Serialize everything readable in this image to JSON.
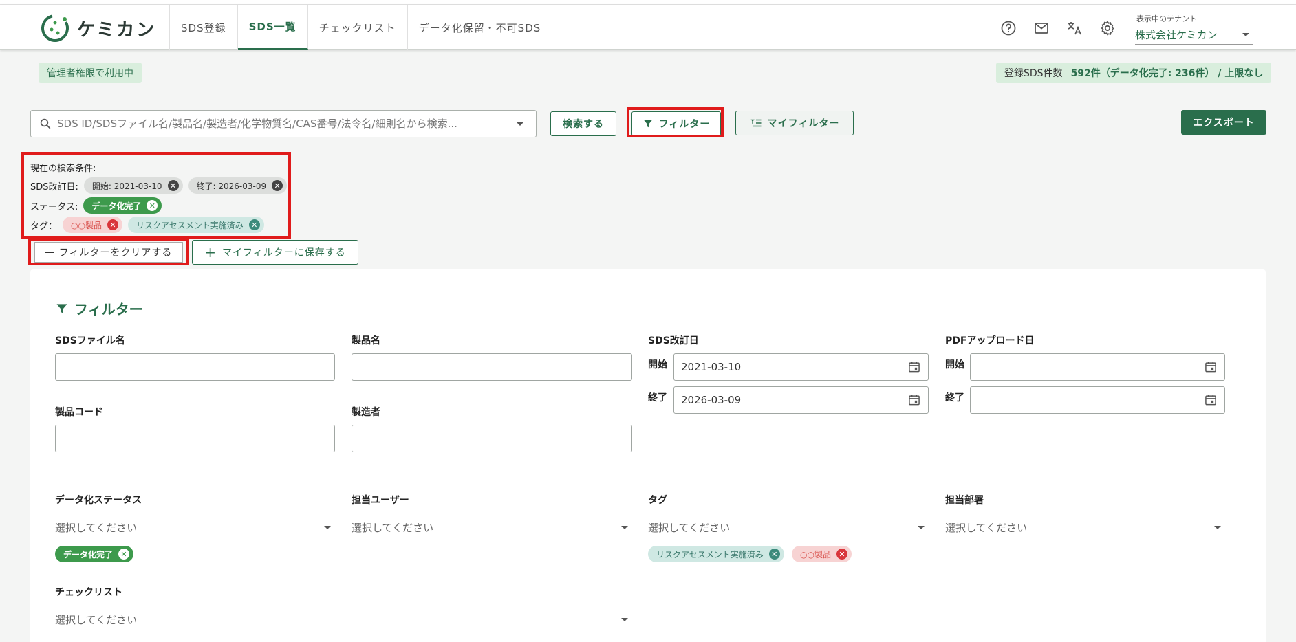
{
  "app": {
    "logo_text": "ケミカン"
  },
  "nav": {
    "tabs": [
      {
        "label": "SDS登録"
      },
      {
        "label": "SDS一覧"
      },
      {
        "label": "チェックリスト"
      },
      {
        "label": "データ化保留・不可SDS"
      }
    ]
  },
  "header": {
    "icons": [
      "help-icon",
      "mail-icon",
      "translate-icon",
      "gear-icon"
    ],
    "tenant_label": "表示中のテナント",
    "tenant_value": "株式会社ケミカン"
  },
  "badges": {
    "admin": "管理者権限で利用中",
    "count_label": "登録SDS件数",
    "count_value": "592件（データ化完了: 236件） / 上限なし"
  },
  "search": {
    "placeholder": "SDS ID/SDSファイル名/製品名/製造者/化学物質名/CAS番号/法令名/細則名から検索...",
    "search_button": "検索する",
    "filter_button": "フィルター",
    "my_filter_button": "マイフィルター",
    "export_button": "エクスポート"
  },
  "conditions": {
    "title": "現在の検索条件:",
    "revision_label": "SDS改訂日:",
    "revision_start": "開始: 2021-03-10",
    "revision_end": "終了: 2026-03-09",
    "status_label": "ステータス:",
    "status_value": "データ化完了",
    "tag_label": "タグ：",
    "tag_1": "○○製品",
    "tag_2": "リスクアセスメント実施済み",
    "clear_button": "フィルターをクリアする",
    "save_button": "マイフィルターに保存する"
  },
  "filter": {
    "title": "フィルター",
    "sds_file_name": {
      "label": "SDSファイル名",
      "value": ""
    },
    "product_name": {
      "label": "製品名",
      "value": ""
    },
    "product_code": {
      "label": "製品コード",
      "value": ""
    },
    "manufacturer": {
      "label": "製造者",
      "value": ""
    },
    "sds_revision_date": {
      "label": "SDS改訂日",
      "start_label": "開始",
      "start": "2021-03-10",
      "end_label": "終了",
      "end": "2026-03-09"
    },
    "pdf_upload_date": {
      "label": "PDFアップロード日",
      "start_label": "開始",
      "start": "",
      "end_label": "終了",
      "end": ""
    },
    "status": {
      "label": "データ化ステータス",
      "placeholder": "選択してください",
      "chip": "データ化完了"
    },
    "user": {
      "label": "担当ユーザー",
      "placeholder": "選択してください"
    },
    "tag": {
      "label": "タグ",
      "placeholder": "選択してください",
      "chip_1": "リスクアセスメント実施済み",
      "chip_2": "○○製品"
    },
    "department": {
      "label": "担当部署",
      "placeholder": "選択してください"
    },
    "checklist": {
      "label": "チェックリスト",
      "placeholder": "選択してください"
    }
  },
  "colors": {
    "brand": "#2a6e4c",
    "highlight": "#e01b1b",
    "status_green": "#3d9a4c"
  }
}
